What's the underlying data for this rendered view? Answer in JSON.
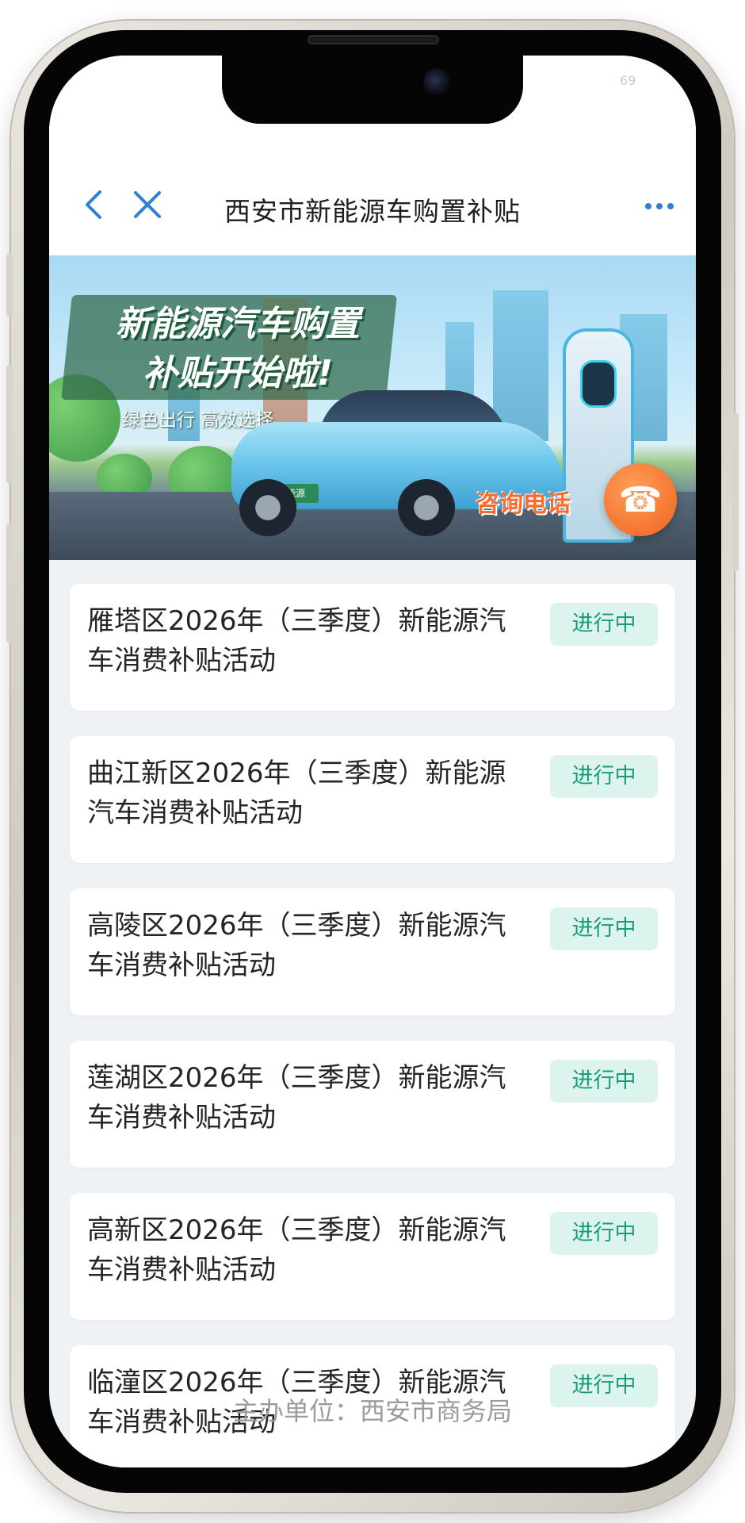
{
  "status": {
    "battery": "69"
  },
  "header": {
    "title": "西安市新能源车购置补贴"
  },
  "banner": {
    "headline_line1": "新能源汽车购置",
    "headline_line2": "补贴开始啦!",
    "subline": "绿色出行  高效选择",
    "plate": "新能源",
    "consult": "咨询电话"
  },
  "items": [
    {
      "title": "雁塔区2026年（三季度）新能源汽车消费补贴活动",
      "status": "进行中"
    },
    {
      "title": "曲江新区2026年（三季度）新能源汽车消费补贴活动",
      "status": "进行中"
    },
    {
      "title": "高陵区2026年（三季度）新能源汽车消费补贴活动",
      "status": "进行中"
    },
    {
      "title": "莲湖区2026年（三季度）新能源汽车消费补贴活动",
      "status": "进行中"
    },
    {
      "title": "高新区2026年（三季度）新能源汽车消费补贴活动",
      "status": "进行中"
    },
    {
      "title": "临潼区2026年（三季度）新能源汽车消费补贴活动",
      "status": "进行中"
    }
  ],
  "footer": {
    "organizer": "主办单位：西安市商务局"
  },
  "colors": {
    "accent": "#2f7fd6",
    "badge_bg": "#ddf4ee",
    "badge_text": "#1a9c7c",
    "consult": "#ff6a2a"
  }
}
